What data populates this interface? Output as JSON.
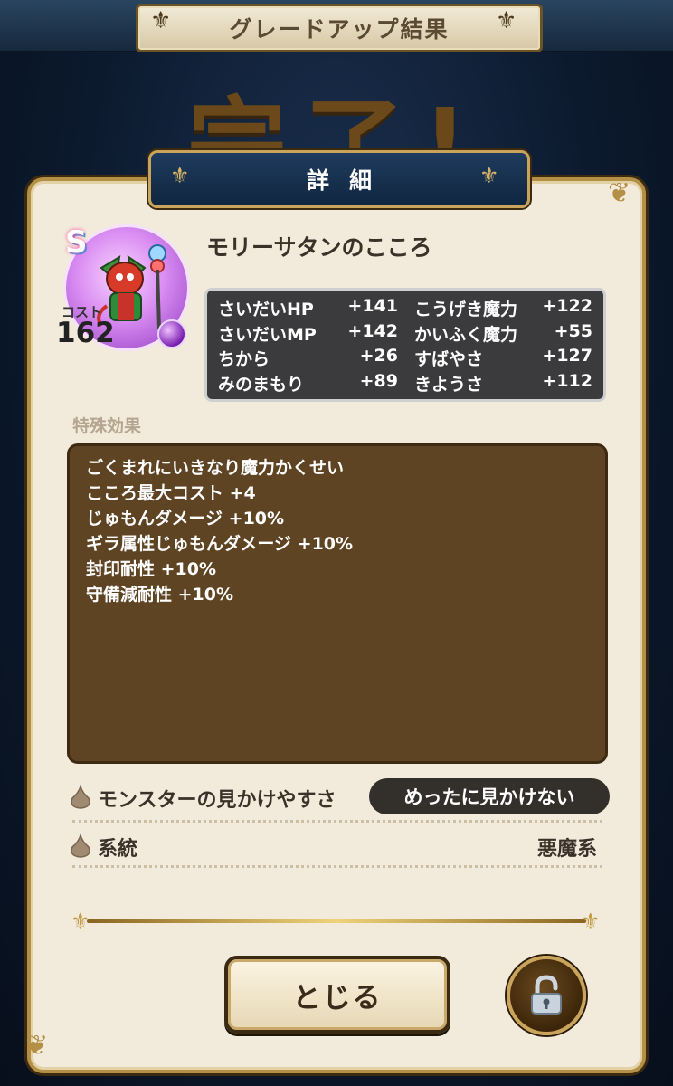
{
  "header": {
    "title": "グレードアップ結果",
    "complete_text": "完了!"
  },
  "panel": {
    "title": "詳細"
  },
  "monster": {
    "rank": "S",
    "cost_label": "コスト",
    "cost_value": "162",
    "name": "モリーサタンのこころ"
  },
  "stats": [
    {
      "label": "さいだいHP",
      "value": "+141",
      "label2": "こうげき魔力",
      "value2": "+122"
    },
    {
      "label": "さいだいMP",
      "value": "+142",
      "label2": "かいふく魔力",
      "value2": "+55"
    },
    {
      "label": "ちから",
      "value": "+26",
      "label2": "すばやさ",
      "value2": "+127"
    },
    {
      "label": "みのまもり",
      "value": "+89",
      "label2": "きようさ",
      "value2": "+112"
    }
  ],
  "special": {
    "title": "特殊効果",
    "effects": [
      "ごくまれにいきなり魔力かくせい",
      "こころ最大コスト +4",
      "じゅもんダメージ +10%",
      "ギラ属性じゅもんダメージ +10%",
      "封印耐性 +10%",
      "守備減耐性 +10%"
    ]
  },
  "info": {
    "visibility_label": "モンスターの見かけやすさ",
    "visibility_value": "めったに見かけない",
    "family_label": "系統",
    "family_value": "悪魔系"
  },
  "buttons": {
    "close": "とじる"
  },
  "icons": {
    "lock": "unlocked-padlock-icon",
    "drop": "drop-icon",
    "orb": "purple-orb-icon"
  },
  "colors": {
    "panel_bg": "#f2ebdb",
    "gold": "#b48f46",
    "effects_bg": "#5f4424",
    "stats_bg": "#3b3b3d"
  }
}
